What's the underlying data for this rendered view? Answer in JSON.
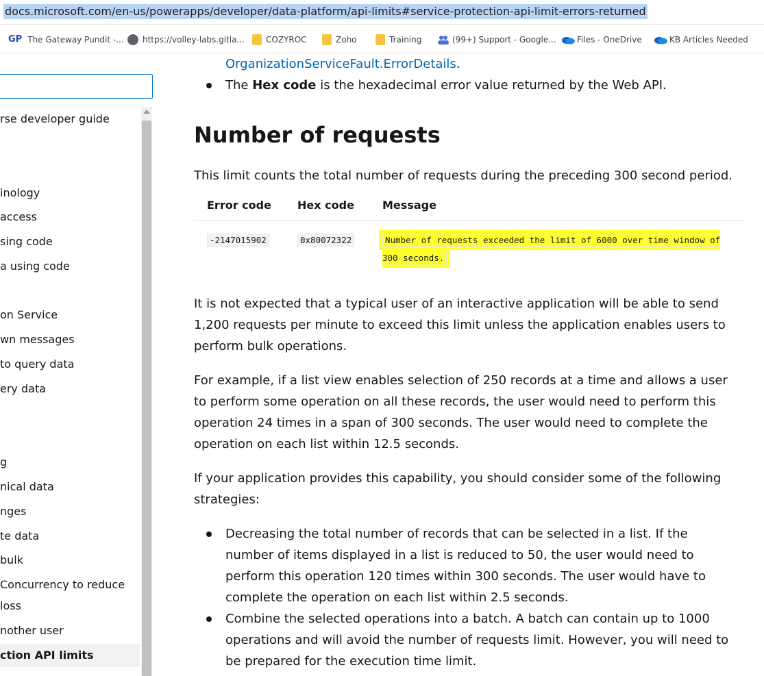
{
  "browser": {
    "url": "docs.microsoft.com/en-us/powerapps/developer/data-platform/api-limits#service-protection-api-limit-errors-returned",
    "bookmarks": [
      {
        "icon": "gp-logo-icon",
        "label": "The Gateway Pundit -..."
      },
      {
        "icon": "globe-icon",
        "label": "https://volley-labs.gitla..."
      },
      {
        "icon": "folder-icon",
        "label": "COZYROC"
      },
      {
        "icon": "folder-icon",
        "label": "Zoho"
      },
      {
        "icon": "folder-icon",
        "label": "Training"
      },
      {
        "icon": "google-groups-icon",
        "label": "(99+) Support - Google..."
      },
      {
        "icon": "onedrive-icon",
        "label": "Files - OneDrive"
      },
      {
        "icon": "onedrive-icon",
        "label": "KB Articles Needed"
      }
    ]
  },
  "nav": {
    "items": [
      "rse developer guide",
      "inology",
      " access",
      "sing code",
      "a using code",
      "on Service",
      "wn messages",
      "to query data",
      "ery data",
      "g",
      "nical data",
      "nges",
      "te data",
      "bulk",
      " Concurrency to reduce",
      "loss",
      "nother user",
      "ction API limits"
    ]
  },
  "content": {
    "bullet1_link": "OrganizationServiceFault.ErrorDetails",
    "bullet1_tail": ".",
    "bullet2_pre": "The ",
    "bullet2_bold": "Hex code",
    "bullet2_post": " is the hexadecimal error value returned by the Web API.",
    "heading": "Number of requests",
    "intro": "This limit counts the total number of requests during the preceding 300 second period.",
    "table": {
      "headers": [
        "Error code",
        "Hex code",
        "Message"
      ],
      "row": {
        "error_code": "-2147015902",
        "hex_code": "0x80072322",
        "message": "Number of requests exceeded the limit of 6000 over time window of 300 seconds."
      }
    },
    "para1": "It is not expected that a typical user of an interactive application will be able to send 1,200 requests per minute to exceed this limit unless the application enables users to perform bulk operations.",
    "para2": "For example, if a list view enables selection of 250 records at a time and allows a user to perform some operation on all these records, the user would need to perform this operation 24 times in a span of 300 seconds. The user would need to complete the operation on each list within 12.5 seconds.",
    "para3": "If your application provides this capability, you should consider some of the following strategies:",
    "bullets": [
      "Decreasing the total number of records that can be selected in a list. If the number of items displayed in a list is reduced to 50, the user would need to perform this operation 120 times within 300 seconds. The user would have to complete the operation on each list within 2.5 seconds.",
      "Combine the selected operations into a batch. A batch can contain up to 1000 operations and will avoid the number of requests limit. However, you will need to be prepared for the execution time limit."
    ]
  },
  "colors": {
    "link": "#0065b3",
    "highlight": "#ffff2e",
    "url_selection": "#b9d3f2"
  }
}
